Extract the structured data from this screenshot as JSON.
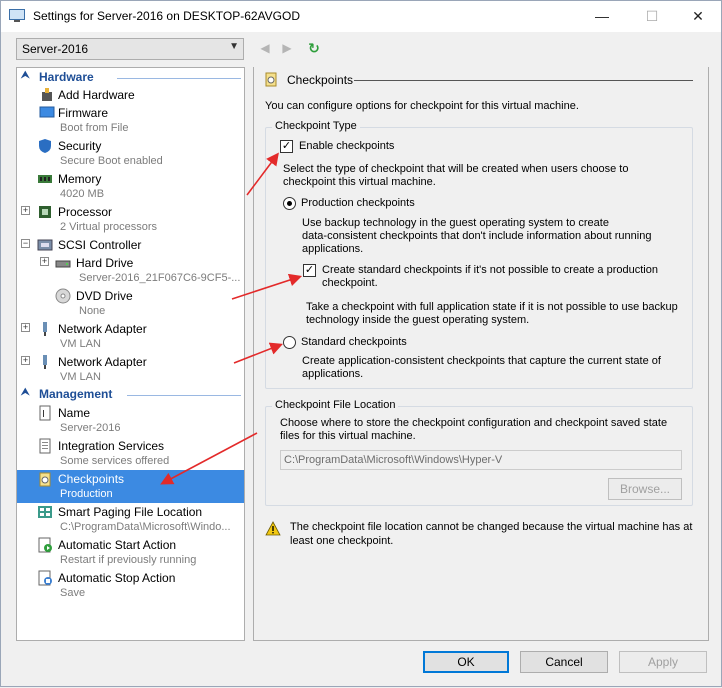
{
  "window": {
    "title": "Settings for Server-2016 on DESKTOP-62AVGOD",
    "minimize": "—",
    "maximize": "☐",
    "close": "✕"
  },
  "toolbar": {
    "vm_selected": "Server-2016",
    "back": "◀",
    "forward": "▶",
    "refresh": "↻"
  },
  "tree": {
    "hardware_header": "Hardware",
    "management_header": "Management",
    "items": [
      {
        "label": "Add Hardware",
        "sub": ""
      },
      {
        "label": "Firmware",
        "sub": "Boot from File"
      },
      {
        "label": "Security",
        "sub": "Secure Boot enabled"
      },
      {
        "label": "Memory",
        "sub": "4020 MB"
      },
      {
        "label": "Processor",
        "sub": "2 Virtual processors"
      },
      {
        "label": "SCSI Controller",
        "sub": ""
      },
      {
        "label": "Hard Drive",
        "sub": "Server-2016_21F067C6-9CF5-..."
      },
      {
        "label": "DVD Drive",
        "sub": "None"
      },
      {
        "label": "Network Adapter",
        "sub": "VM LAN"
      },
      {
        "label": "Network Adapter",
        "sub": "VM LAN"
      },
      {
        "label": "Name",
        "sub": "Server-2016"
      },
      {
        "label": "Integration Services",
        "sub": "Some services offered"
      },
      {
        "label": "Checkpoints",
        "sub": "Production"
      },
      {
        "label": "Smart Paging File Location",
        "sub": "C:\\ProgramData\\Microsoft\\Windo..."
      },
      {
        "label": "Automatic Start Action",
        "sub": "Restart if previously running"
      },
      {
        "label": "Automatic Stop Action",
        "sub": "Save"
      }
    ]
  },
  "panel": {
    "title": "Checkpoints",
    "intro": "You can configure options for checkpoint for this virtual machine.",
    "type_group": "Checkpoint Type",
    "enable_label": "Enable checkpoints",
    "select_line1": "Select the type of checkpoint that will be created when users choose to",
    "select_line2": "checkpoint this virtual machine.",
    "production_label": "Production checkpoints",
    "production_desc1": "Use backup technology in the guest operating system to create",
    "production_desc2": "data-consistent checkpoints that don't include information about running",
    "production_desc3": "applications.",
    "create_std_line1": "Create standard checkpoints if it's not possible to create a production",
    "create_std_line2": "checkpoint.",
    "fullstate_line1": "Take a checkpoint with full application state if it is not possible to use backup",
    "fullstate_line2": "technology inside the guest operating system.",
    "standard_label": "Standard checkpoints",
    "standard_desc1": "Create application-consistent checkpoints that capture the current state of",
    "standard_desc2": "applications.",
    "location_group": "Checkpoint File Location",
    "location_desc1": "Choose where to store the checkpoint configuration and checkpoint saved state",
    "location_desc2": "files for this virtual machine.",
    "location_path": "C:\\ProgramData\\Microsoft\\Windows\\Hyper-V",
    "browse": "Browse...",
    "warning1": "The checkpoint file location cannot be changed because the virtual machine has at",
    "warning2": "least one checkpoint."
  },
  "state": {
    "enable_checked": true,
    "production_selected": true,
    "create_std_checked": true
  },
  "footer": {
    "ok": "OK",
    "cancel": "Cancel",
    "apply": "Apply"
  },
  "colors": {
    "selection": "#3c8ae2",
    "header_text": "#1e4e96",
    "arrow": "#e32a2a"
  }
}
